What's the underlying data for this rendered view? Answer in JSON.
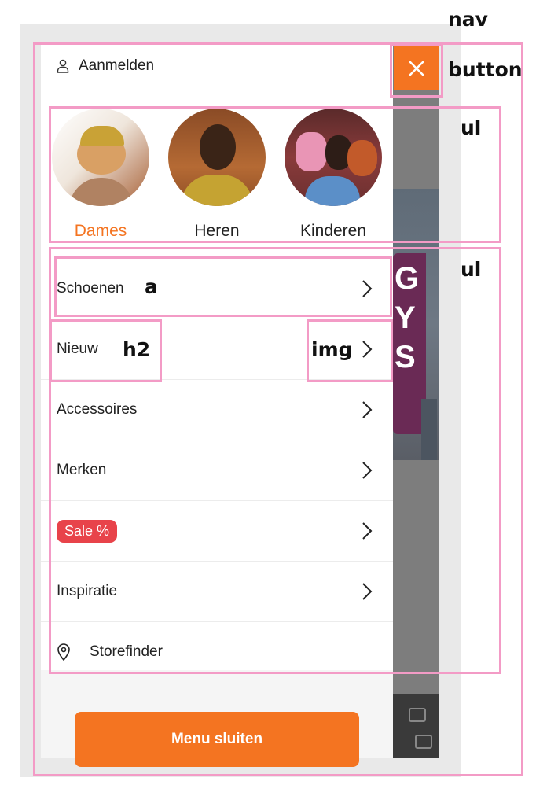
{
  "nav": {
    "signin_label": "Aanmelden",
    "signin_icon": "user-icon",
    "close_icon": "close-icon",
    "accent_color": "#f47421"
  },
  "categories": [
    {
      "label": "Dames",
      "active": true
    },
    {
      "label": "Heren",
      "active": false
    },
    {
      "label": "Kinderen",
      "active": false
    }
  ],
  "menu": [
    {
      "label": "Schoenen"
    },
    {
      "label": "Nieuw"
    },
    {
      "label": "Accessoires"
    },
    {
      "label": "Merken"
    },
    {
      "label": "Sale %",
      "badge_color": "#e8434a"
    },
    {
      "label": "Inspiratie"
    },
    {
      "label": "Storefinder",
      "icon": "location-pin-icon"
    }
  ],
  "close_menu_label": "Menu sluiten",
  "annotations": [
    "nav",
    "button",
    "ul",
    "ul",
    "a",
    "h2",
    "img"
  ],
  "annotation_color": "#f39bc6"
}
